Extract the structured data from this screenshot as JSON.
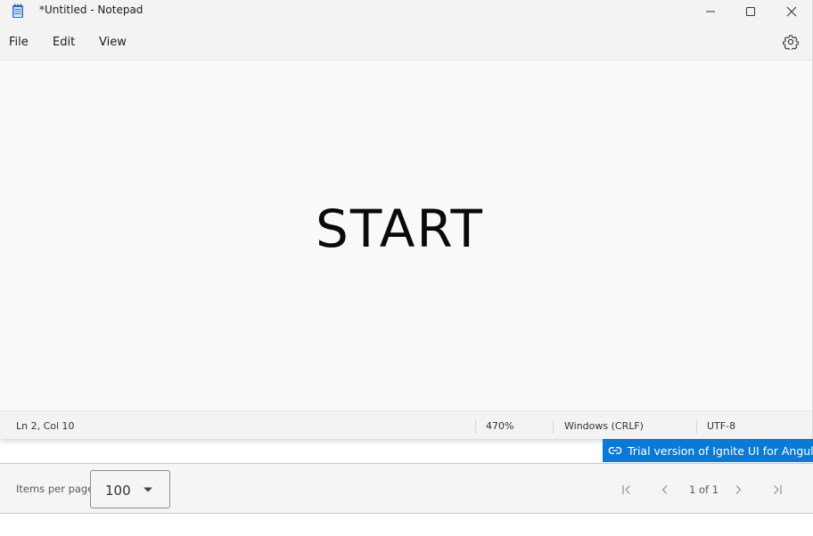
{
  "window": {
    "title": "*Untitled - Notepad",
    "icons": {
      "app": "notepad-icon",
      "minimize": "minimize-icon",
      "maximize": "maximize-icon",
      "close": "close-icon"
    }
  },
  "menubar": {
    "items": [
      {
        "label": "File"
      },
      {
        "label": "Edit"
      },
      {
        "label": "View"
      }
    ],
    "settings_icon": "gear-icon"
  },
  "editor": {
    "content": "START"
  },
  "statusbar": {
    "position": "Ln 2, Col 10",
    "zoom": "470%",
    "line_ending": "Windows (CRLF)",
    "encoding": "UTF-8"
  },
  "trial_banner": {
    "text": "Trial version of Ignite UI for Angular",
    "icon": "link-icon",
    "color": "#0a7ad6"
  },
  "paginator": {
    "items_per_page_label": "Items per page",
    "items_per_page_value": "100",
    "page_info": "1 of 1",
    "icons": {
      "first": "first-page-icon",
      "prev": "previous-page-icon",
      "next": "next-page-icon",
      "last": "last-page-icon",
      "caret": "caret-down-icon"
    }
  }
}
